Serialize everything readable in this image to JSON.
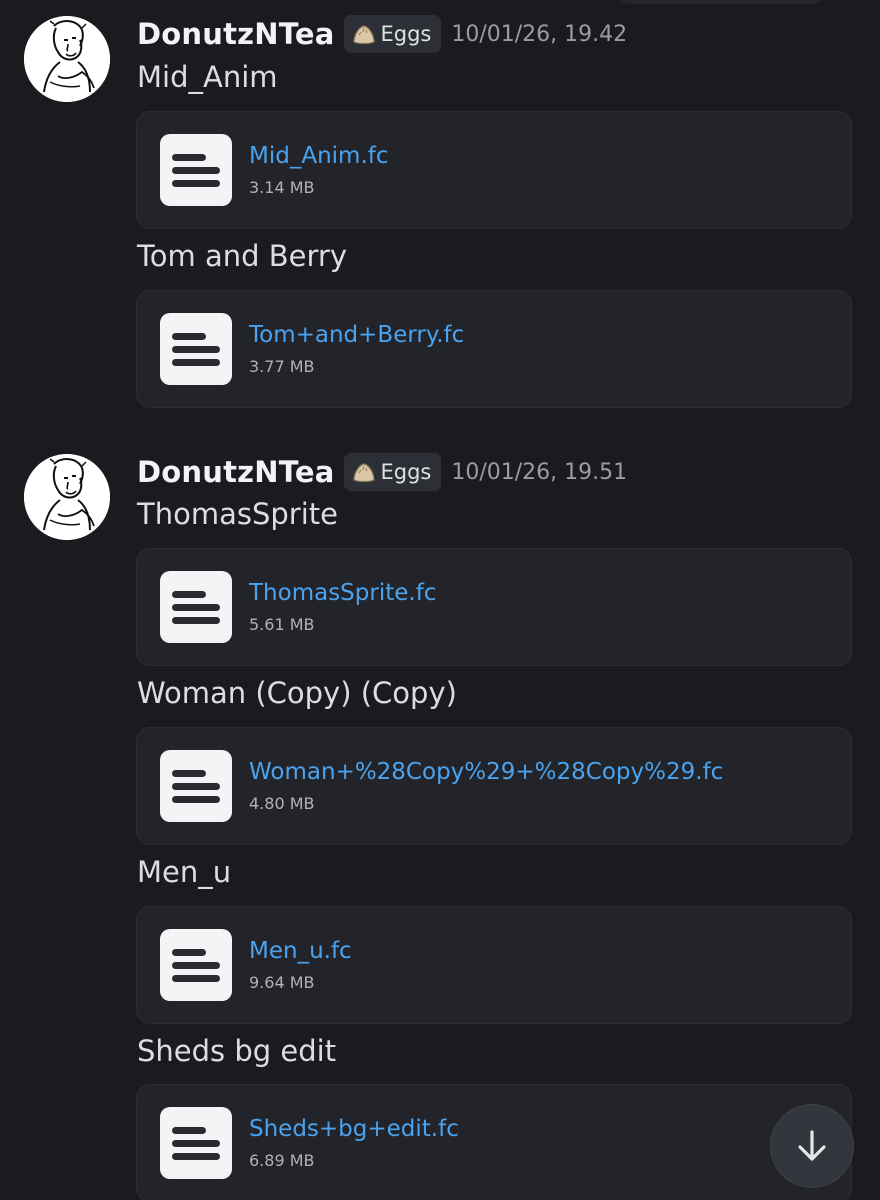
{
  "messages": [
    {
      "username": "DonutzNTea",
      "role": {
        "name": "Eggs",
        "icon": "dumpling-icon"
      },
      "timestamp": "10/01/26, 19.42",
      "posts": [
        {
          "text": "Mid_Anim",
          "file": {
            "name": "Mid_Anim.fc",
            "size": "3.14 MB"
          }
        },
        {
          "text": "Tom and Berry",
          "file": {
            "name": "Tom+and+Berry.fc",
            "size": "3.77 MB"
          }
        }
      ]
    },
    {
      "username": "DonutzNTea",
      "role": {
        "name": "Eggs",
        "icon": "dumpling-icon"
      },
      "timestamp": "10/01/26, 19.51",
      "posts": [
        {
          "text": "ThomasSprite",
          "file": {
            "name": "ThomasSprite.fc",
            "size": "5.61 MB"
          }
        },
        {
          "text": "Woman (Copy) (Copy)",
          "file": {
            "name": "Woman+%28Copy%29+%28Copy%29.fc",
            "size": "4.80 MB"
          }
        },
        {
          "text": "Men_u",
          "file": {
            "name": "Men_u.fc",
            "size": "9.64 MB"
          }
        },
        {
          "text": "Sheds bg edit",
          "file": {
            "name": "Sheds+bg+edit.fc",
            "size": "6.89 MB"
          }
        }
      ]
    }
  ],
  "colors": {
    "background": "#1b1b1f",
    "attachment_bg": "#232429",
    "link": "#4aa3f0",
    "timestamp": "#9a9ca4"
  },
  "icons": {
    "file": "document-lines-icon",
    "scroll": "arrow-down-icon"
  }
}
